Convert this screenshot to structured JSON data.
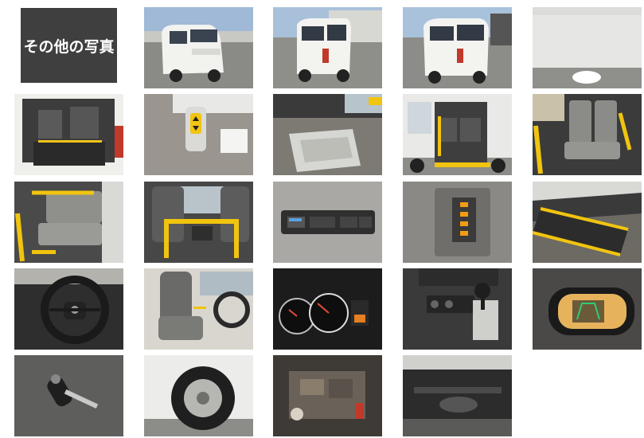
{
  "gallery": {
    "title": "その他の写真",
    "photos": [
      {
        "name": "van-front-exterior"
      },
      {
        "name": "van-rear-left-exterior"
      },
      {
        "name": "van-rear-right-exterior"
      },
      {
        "name": "ceiling-interior"
      },
      {
        "name": "rear-cargo-lift-interior"
      },
      {
        "name": "lift-remote-controller"
      },
      {
        "name": "rear-wheelchair-lift"
      },
      {
        "name": "side-door-seats"
      },
      {
        "name": "rear-seats-yellow-handrails"
      },
      {
        "name": "folding-seat-handrail"
      },
      {
        "name": "front-seat-handrail"
      },
      {
        "name": "overhead-control-switches"
      },
      {
        "name": "interior-light-switch"
      },
      {
        "name": "side-step-yellow-edge"
      },
      {
        "name": "steering-wheel"
      },
      {
        "name": "driver-seat"
      },
      {
        "name": "instrument-cluster"
      },
      {
        "name": "center-console-shifter"
      },
      {
        "name": "rearview-mirror-camera"
      },
      {
        "name": "car-key"
      },
      {
        "name": "front-tire-wheel"
      },
      {
        "name": "engine-bay"
      },
      {
        "name": "undercarriage"
      }
    ]
  }
}
